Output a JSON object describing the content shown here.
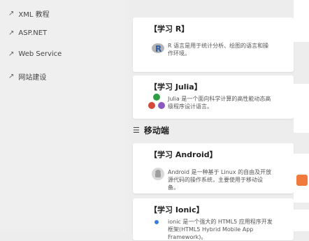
{
  "sidebar": {
    "items": [
      {
        "label": "XML 教程"
      },
      {
        "label": "ASP.NET"
      },
      {
        "label": "Web Service"
      },
      {
        "label": "网站建设"
      }
    ]
  },
  "main": {
    "cards": [
      {
        "title": "【学习 R】",
        "desc": "R 语言是用于统计分析、绘图的语言和操作环境。"
      },
      {
        "title": "【学习 Julia】",
        "desc": "Julia 是一个面向科学计算的高性能动态高级程序设计语言。"
      }
    ],
    "section": {
      "title": "移动端"
    },
    "mobile_cards": [
      {
        "title": "【学习 Android】",
        "desc": "Android 是一种基于 Linux 的自由及开放源代码的操作系统，主要使用于移动设备。"
      },
      {
        "title": "【学习 Ionic】",
        "desc": "ionic 是一个强大的 HTML5 应用程序开发框架(HTML5 Hybrid Mobile App Framework)。"
      }
    ]
  },
  "colors": {
    "r_blue": "#2d5fa8",
    "julia_green": "#2e9e44",
    "julia_red": "#d44a3a",
    "julia_purple": "#8a5ac1",
    "android_gray": "#9e9e9e",
    "ionic_blue": "#3a7be0"
  }
}
